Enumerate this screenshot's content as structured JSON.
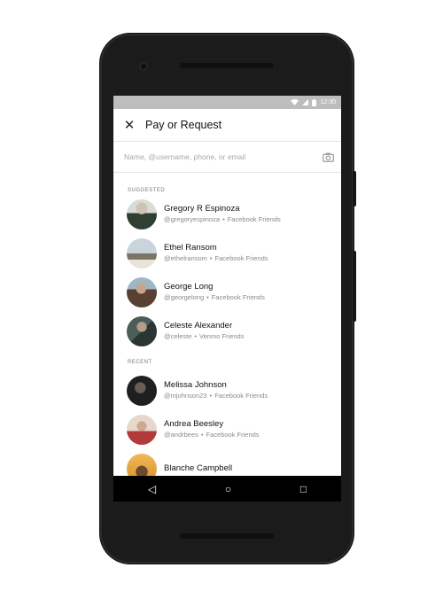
{
  "status_bar": {
    "time": "12:30"
  },
  "app_bar": {
    "close_glyph": "✕",
    "title": "Pay or Request"
  },
  "search": {
    "placeholder": "Name, @username, phone, or email",
    "camera_icon": "camera-icon"
  },
  "suggested": {
    "header": "SUGGESTED",
    "people": [
      {
        "name": "Gregory R Espinoza",
        "username": "@gregoryespinoza",
        "source": "Facebook Friends"
      },
      {
        "name": "Ethel Ransom",
        "username": "@ethelransom",
        "source": "Facebook Friends"
      },
      {
        "name": "George Long",
        "username": "@georgelong",
        "source": "Facebook Friends"
      },
      {
        "name": "Celeste Alexander",
        "username": "@celeste",
        "source": "Venmo Friends"
      }
    ]
  },
  "recent": {
    "header": "RECENT",
    "people": [
      {
        "name": "Melissa Johnson",
        "username": "@mjohnson23",
        "source": "Facebook Friends"
      },
      {
        "name": "Andrea Beesley",
        "username": "@andrbees",
        "source": "Facebook Friends"
      },
      {
        "name": "Blanche Campbell",
        "username": "",
        "source": ""
      }
    ]
  },
  "nav_bar": {
    "back": "◁",
    "home": "○",
    "recents": "□"
  },
  "colors": {
    "statusbar": "#bdbdbd",
    "phone_body": "#1b1b1b",
    "navbar": "#000000"
  }
}
